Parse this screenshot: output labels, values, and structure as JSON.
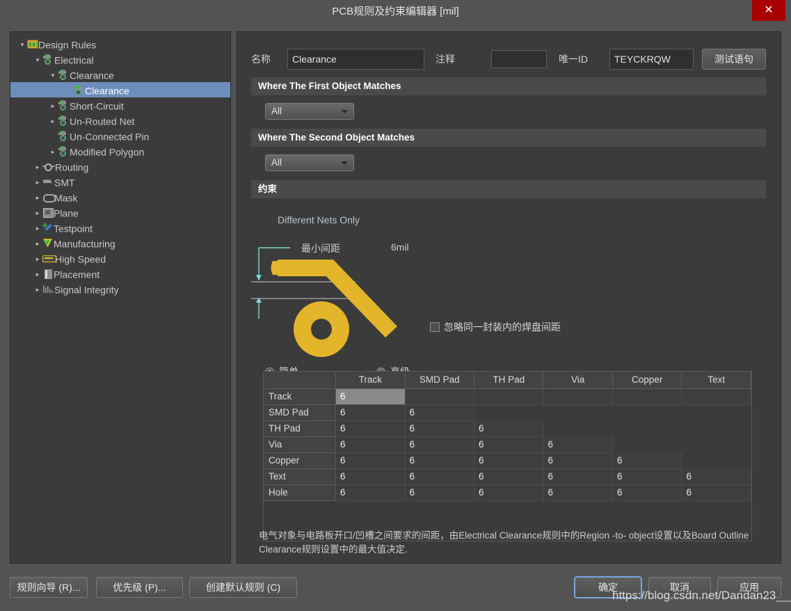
{
  "window": {
    "title": "PCB规则及约束编辑器 [mil]",
    "close_label": "✕"
  },
  "tree": {
    "items": [
      {
        "label": "Design Rules",
        "depth": 0,
        "twist": "▾",
        "icon": "folder-icon",
        "selected": false
      },
      {
        "label": "Electrical",
        "depth": 1,
        "twist": "▾",
        "icon": "electrical-icon",
        "selected": false
      },
      {
        "label": "Clearance",
        "depth": 2,
        "twist": "▾",
        "icon": "electrical-icon",
        "selected": false
      },
      {
        "label": "Clearance",
        "depth": 3,
        "twist": "",
        "icon": "electrical-icon",
        "selected": true
      },
      {
        "label": "Short-Circuit",
        "depth": 2,
        "twist": "▸",
        "icon": "electrical-icon",
        "selected": false
      },
      {
        "label": "Un-Routed Net",
        "depth": 2,
        "twist": "▸",
        "icon": "electrical-icon",
        "selected": false
      },
      {
        "label": "Un-Connected Pin",
        "depth": 2,
        "twist": "",
        "icon": "electrical-icon",
        "selected": false
      },
      {
        "label": "Modified Polygon",
        "depth": 2,
        "twist": "▸",
        "icon": "electrical-icon",
        "selected": false
      },
      {
        "label": "Routing",
        "depth": 1,
        "twist": "▸",
        "icon": "routing-icon",
        "selected": false
      },
      {
        "label": "SMT",
        "depth": 1,
        "twist": "▸",
        "icon": "smt-icon",
        "selected": false
      },
      {
        "label": "Mask",
        "depth": 1,
        "twist": "▸",
        "icon": "mask-icon",
        "selected": false
      },
      {
        "label": "Plane",
        "depth": 1,
        "twist": "▸",
        "icon": "plane-icon",
        "selected": false
      },
      {
        "label": "Testpoint",
        "depth": 1,
        "twist": "▸",
        "icon": "testpoint-icon",
        "selected": false
      },
      {
        "label": "Manufacturing",
        "depth": 1,
        "twist": "▸",
        "icon": "manufacturing-icon",
        "selected": false
      },
      {
        "label": "High Speed",
        "depth": 1,
        "twist": "▸",
        "icon": "highspeed-icon",
        "selected": false
      },
      {
        "label": "Placement",
        "depth": 1,
        "twist": "▸",
        "icon": "placement-icon",
        "selected": false
      },
      {
        "label": "Signal Integrity",
        "depth": 1,
        "twist": "▸",
        "icon": "signalintegrity-icon",
        "selected": false
      }
    ]
  },
  "form": {
    "name_label": "名称",
    "name_value": "Clearance",
    "comment_label": "注释",
    "comment_value": "",
    "uniqueid_label": "唯一ID",
    "uniqueid_value": "TEYCKRQW",
    "test_button": "测试语句"
  },
  "sections": {
    "first_object": {
      "header": "Where The First Object Matches",
      "dropdown_value": "All"
    },
    "second_object": {
      "header": "Where The Second Object Matches",
      "dropdown_value": "All"
    },
    "constraints": {
      "header": "约束"
    }
  },
  "constraints": {
    "different_nets_only": "Different Nets Only",
    "min_clearance_label": "最小间距",
    "min_clearance_value": "6mil",
    "ignore_pad_checkbox": "忽略同一封装内的焊盘间距",
    "ignore_pad_checked": false,
    "mode_simple": "简单",
    "mode_advanced": "高级",
    "mode_selected": "简单"
  },
  "matrix": {
    "columns": [
      "Track",
      "SMD Pad",
      "TH Pad",
      "Via",
      "Copper",
      "Text"
    ],
    "rows": [
      {
        "label": "Track",
        "values": [
          "6",
          "",
          "",
          "",
          "",
          ""
        ],
        "filled": 1
      },
      {
        "label": "SMD Pad",
        "values": [
          "6",
          "6",
          "",
          "",
          "",
          ""
        ],
        "filled": 2
      },
      {
        "label": "TH Pad",
        "values": [
          "6",
          "6",
          "6",
          "",
          "",
          ""
        ],
        "filled": 3
      },
      {
        "label": "Via",
        "values": [
          "6",
          "6",
          "6",
          "6",
          "",
          ""
        ],
        "filled": 4
      },
      {
        "label": "Copper",
        "values": [
          "6",
          "6",
          "6",
          "6",
          "6",
          ""
        ],
        "filled": 5
      },
      {
        "label": "Text",
        "values": [
          "6",
          "6",
          "6",
          "6",
          "6",
          "6"
        ],
        "filled": 6
      },
      {
        "label": "Hole",
        "values": [
          "6",
          "6",
          "6",
          "6",
          "6",
          "6"
        ],
        "filled": 6
      }
    ],
    "selected_cell": {
      "row": 0,
      "col": 0
    }
  },
  "description": "电气对象与电路板开口/凹槽之间要求的间距，由Electrical Clearance规则中的Region -to- object设置以及Board Outline Clearance规则设置中的最大值决定.",
  "footer": {
    "rule_wizard": "规则向导 (R)...",
    "priorities": "优先级 (P)...",
    "create_default": "创建默认规则 (C)",
    "ok": "确定",
    "cancel": "取消",
    "apply": "应用"
  },
  "watermark": "https://blog.csdn.net/Dandan23___",
  "colors": {
    "accent_trace": "#e2b52a",
    "dimension_arrow": "#7fd8d0",
    "selection": "#6c8ebc",
    "close_button": "#a80000",
    "panel_bg": "#3b3b3b",
    "window_bg": "#535353"
  }
}
